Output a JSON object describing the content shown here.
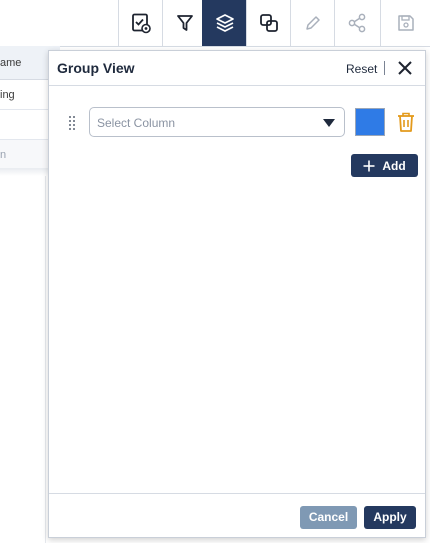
{
  "toolbar": {
    "icons": [
      "checklist-visibility-icon",
      "filter-icon",
      "layers-icon",
      "copy-icon",
      "edit-icon",
      "share-icon",
      "save-icon"
    ],
    "active_icon": "layers-icon"
  },
  "background_table": {
    "header": "ame",
    "rows": [
      "ing",
      "",
      "n"
    ]
  },
  "panel": {
    "title": "Group View",
    "reset_label": "Reset",
    "close_icon": "close-icon",
    "group_row": {
      "select_placeholder": "Select Column",
      "swatch_color": "#2f7be6",
      "delete_icon": "trash-icon"
    },
    "add_label": "Add",
    "cancel_label": "Cancel",
    "apply_label": "Apply"
  },
  "colors": {
    "primary": "#24395f",
    "disabled_button": "#7f99b4",
    "delete_orange": "#e39a1c",
    "swatch_blue": "#2f7be6"
  }
}
